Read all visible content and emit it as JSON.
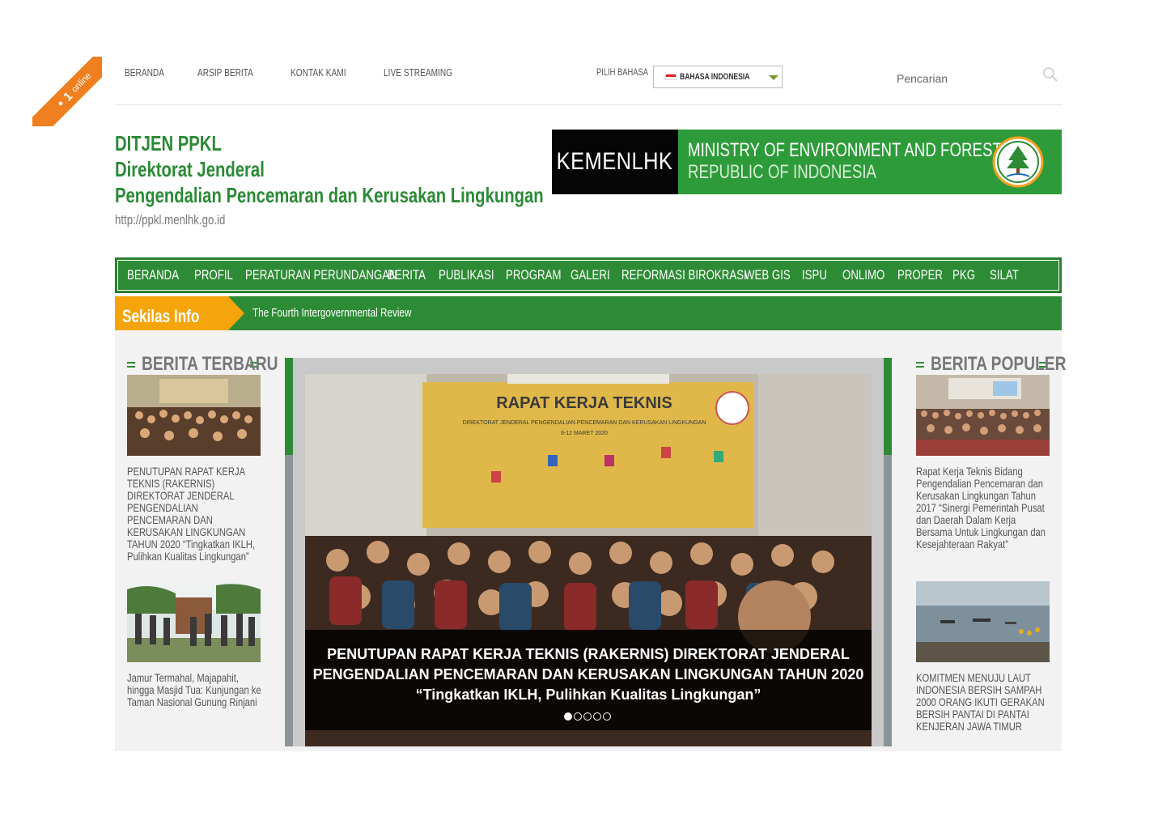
{
  "online_badge": {
    "count": "1",
    "label": "online"
  },
  "top_nav": [
    "BERANDA",
    "ARSIP BERITA",
    "KONTAK KAMI",
    "LIVE STREAMING"
  ],
  "language": {
    "label": "PILIH BAHASA",
    "selected": "BAHASA INDONESIA"
  },
  "search": {
    "placeholder": "Pencarian"
  },
  "brand": {
    "line1": "DITJEN PPKL",
    "line2": "Direktorat Jenderal",
    "line3": "Pengendalian Pencemaran dan Kerusakan Lingkungan",
    "url": "http://ppkl.menlhk.go.id"
  },
  "banner": {
    "abbr": "KEMENLHK",
    "line1": "MINISTRY OF ENVIRONMENT AND FORESTRY",
    "line2": "REPUBLIC OF INDONESIA"
  },
  "main_nav": [
    "BERANDA",
    "PROFIL",
    "PERATURAN PERUNDANGAN",
    "BERITA",
    "PUBLIKASI",
    "PROGRAM",
    "GALERI",
    "REFORMASI BIROKRASI",
    "WEB GIS",
    "ISPU",
    "ONLIMO",
    "PROPER",
    "PKG",
    "SILAT"
  ],
  "ticker": {
    "label": "Sekilas Info",
    "text": "The Fourth Intergovernmental Review"
  },
  "latest": {
    "title": "BERITA TERBARU",
    "items": [
      "PENUTUPAN RAPAT KERJA TEKNIS (RAKERNIS) DIREKTORAT JENDERAL PENGENDALIAN PENCEMARAN DAN KERUSAKAN LINGKUNGAN TAHUN 2020 “Tingkatkan IKLH, Pulihkan Kualitas Lingkungan”",
      "Jamur Termahal, Majapahit, hingga Masjid Tua: Kunjungan ke Taman Nasional Gunung Rinjani"
    ]
  },
  "popular": {
    "title": "BERITA POPULER",
    "items": [
      "Rapat Kerja Teknis Bidang Pengendalian Pencemaran dan Kerusakan Lingkungan Tahun 2017 “Sinergi Pemerintah Pusat dan Daerah Dalam Kerja Bersama Untuk Lingkungan dan Kesejahteraan Rakyat”",
      "KOMITMEN MENUJU LAUT INDONESIA BERSIH SAMPAH 2000 ORANG IKUTI GERAKAN BERSIH PANTAI DI PANTAI KENJERAN JAWA TIMUR"
    ]
  },
  "slider": {
    "photo_banner_title": "RAPAT KERJA TEKNIS",
    "photo_banner_sub1": "DIREKTORAT JENDERAL PENGENDALIAN PENCEMARAN DAN KERUSAKAN LINGKUNGAN",
    "photo_banner_sub2": "8-12 MARET 2020",
    "caption_line1": "PENUTUPAN RAPAT KERJA TEKNIS (RAKERNIS) DIREKTORAT JENDERAL",
    "caption_line2": "PENGENDALIAN PENCEMARAN DAN KERUSAKAN LINGKUNGAN TAHUN 2020",
    "caption_line3": "“Tingkatkan IKLH, Pulihkan Kualitas Lingkungan”",
    "active_dot": 1,
    "dot_count": 5
  },
  "colors": {
    "brand_green": "#2e8b35",
    "accent_orange": "#f5a40b",
    "ribbon_orange": "#f07f1f"
  }
}
